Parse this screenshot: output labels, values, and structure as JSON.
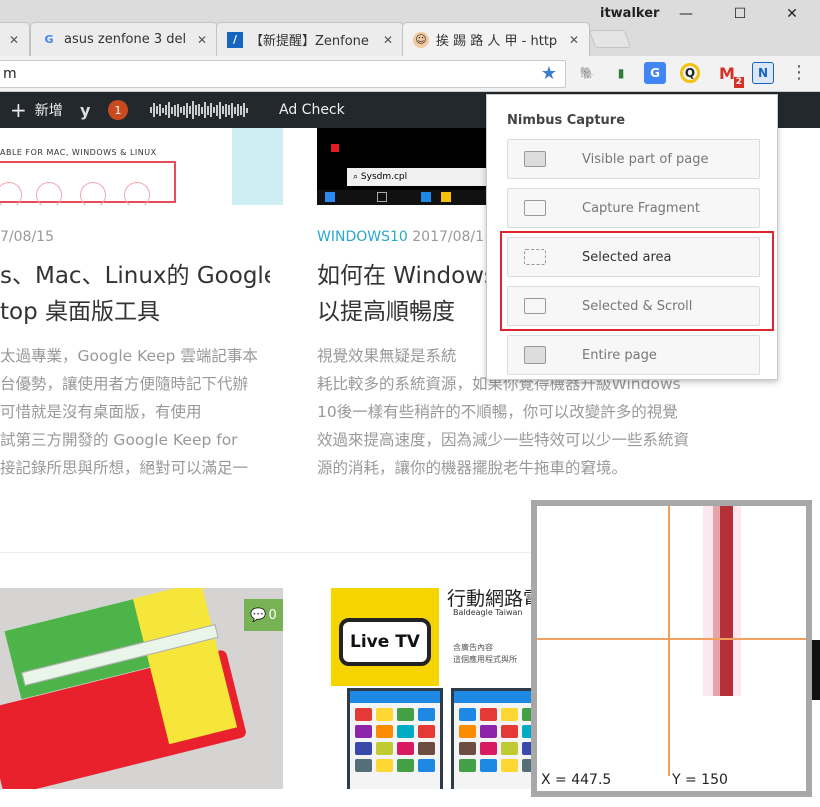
{
  "browser": {
    "user_name": "itwalker",
    "tabs": [
      {
        "favicon": "google-g-icon",
        "title": "asus zenfone 3 del",
        "close": "✕"
      },
      {
        "favicon": "blue-slash-icon",
        "title": "【新提醒】Zenfone",
        "close": "✕"
      },
      {
        "favicon": "person-avatar-icon",
        "title": "挨 踢 路 人 甲 - http",
        "close": "✕"
      }
    ],
    "address": "m",
    "window_controls": [
      "minimize-icon",
      "maximize-icon",
      "close-icon"
    ],
    "extensions": [
      {
        "name": "evernote-icon",
        "color": "#333333"
      },
      {
        "name": "green-clip-icon",
        "color": "#2e7d32"
      },
      {
        "name": "google-translate-icon",
        "color": "#4285f4"
      },
      {
        "name": "yellow-q-icon",
        "color": "#f4c20d"
      },
      {
        "name": "gmail-icon",
        "color": "#d93025",
        "badge": "2"
      },
      {
        "name": "nimbus-icon",
        "color": "#1565c0"
      }
    ]
  },
  "adminbar": {
    "new_label": "新增",
    "notifications": "1",
    "ad_check": "Ad Check"
  },
  "posts": [
    {
      "caption": "ABLE FOR MAC, WINDOWS & LINUX",
      "date": "7/08/15",
      "headline_lines": [
        "s、Mac、Linux的 Google",
        "top 桌面版工具"
      ],
      "excerpt_lines": [
        "太過專業，Google Keep 雲端記事本",
        "台優勢，讓使用者方便隨時記下代辦",
        "可惜就是沒有桌面版，有使用",
        "試第三方開發的 Google Keep for",
        "接記錄所思與所想，絕對可以滿足一"
      ]
    },
    {
      "search_text": "Sysdm.cpl",
      "category": "WINDOWS10",
      "date": "2017/08/1",
      "headline_lines": [
        "如何在 Windows",
        "以提高順暢度"
      ],
      "excerpt_lines": [
        "視覺效果無疑是系統",
        "耗比較多的系統資源，如果你覺得機器升級Windows",
        "10後一樣有些稍許的不順暢，你可以改變許多的視覺",
        "效過來提高速度，因為減少一些特效可以少一些系統資",
        "源的消耗，讓你的機器擺脫老牛拖車的窘境。"
      ]
    }
  ],
  "post3": {
    "comments": "0"
  },
  "post4": {
    "tv_text": "Live TV",
    "app_title": "行動網路電",
    "app_dev": "Baldeagle Taiwan",
    "app_meta_1": "含廣告內容",
    "app_meta_2": "這個應用程式與所"
  },
  "nimbus": {
    "title": "Nimbus Capture",
    "options": [
      {
        "label": "Visible part of page",
        "icon": "visible-page-icon"
      },
      {
        "label": "Capture Fragment",
        "icon": "fragment-icon"
      },
      {
        "label": "Selected area",
        "icon": "selected-area-icon"
      },
      {
        "label": "Selected & Scroll",
        "icon": "scroll-icon"
      },
      {
        "label": "Entire page",
        "icon": "entire-page-icon"
      }
    ],
    "highlight_color": "#e0242f"
  },
  "magnifier": {
    "x_label": "X = 447.5",
    "y_label": "Y = 150"
  }
}
